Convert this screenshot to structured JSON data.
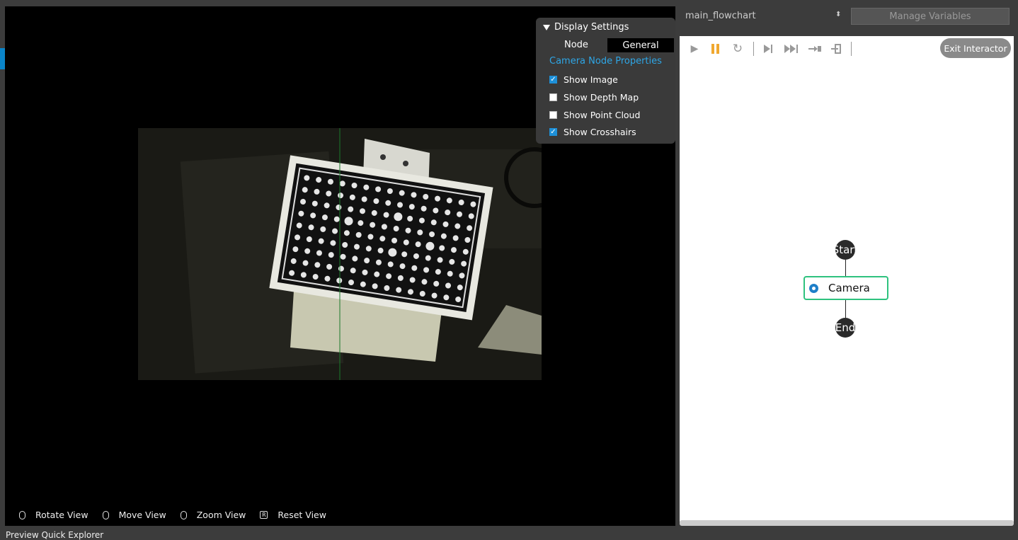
{
  "display_settings": {
    "title": "Display Settings",
    "node_label": "Node",
    "node_value": "General",
    "section": "Camera Node Properties",
    "options": [
      {
        "label": "Show Image",
        "checked": true
      },
      {
        "label": "Show Depth Map",
        "checked": false
      },
      {
        "label": "Show Point Cloud",
        "checked": false
      },
      {
        "label": "Show Crosshairs",
        "checked": true
      }
    ]
  },
  "view_bar": {
    "rotate": "Rotate View",
    "move": "Move View",
    "zoom": "Zoom View",
    "reset": "Reset View",
    "reset_key": "R"
  },
  "flow": {
    "selected_flowchart": "main_flowchart",
    "manage_variables": "Manage Variables",
    "exit_interactor": "Exit Interactor",
    "nodes": {
      "start": "Start",
      "camera": "Camera",
      "end": "End"
    }
  },
  "bottom_tabs": "Preview Quick Explorer",
  "colors": {
    "accent": "#0a84c8",
    "link": "#2ea6e6",
    "node_border": "#2ec27e",
    "pause": "#f0a830"
  }
}
